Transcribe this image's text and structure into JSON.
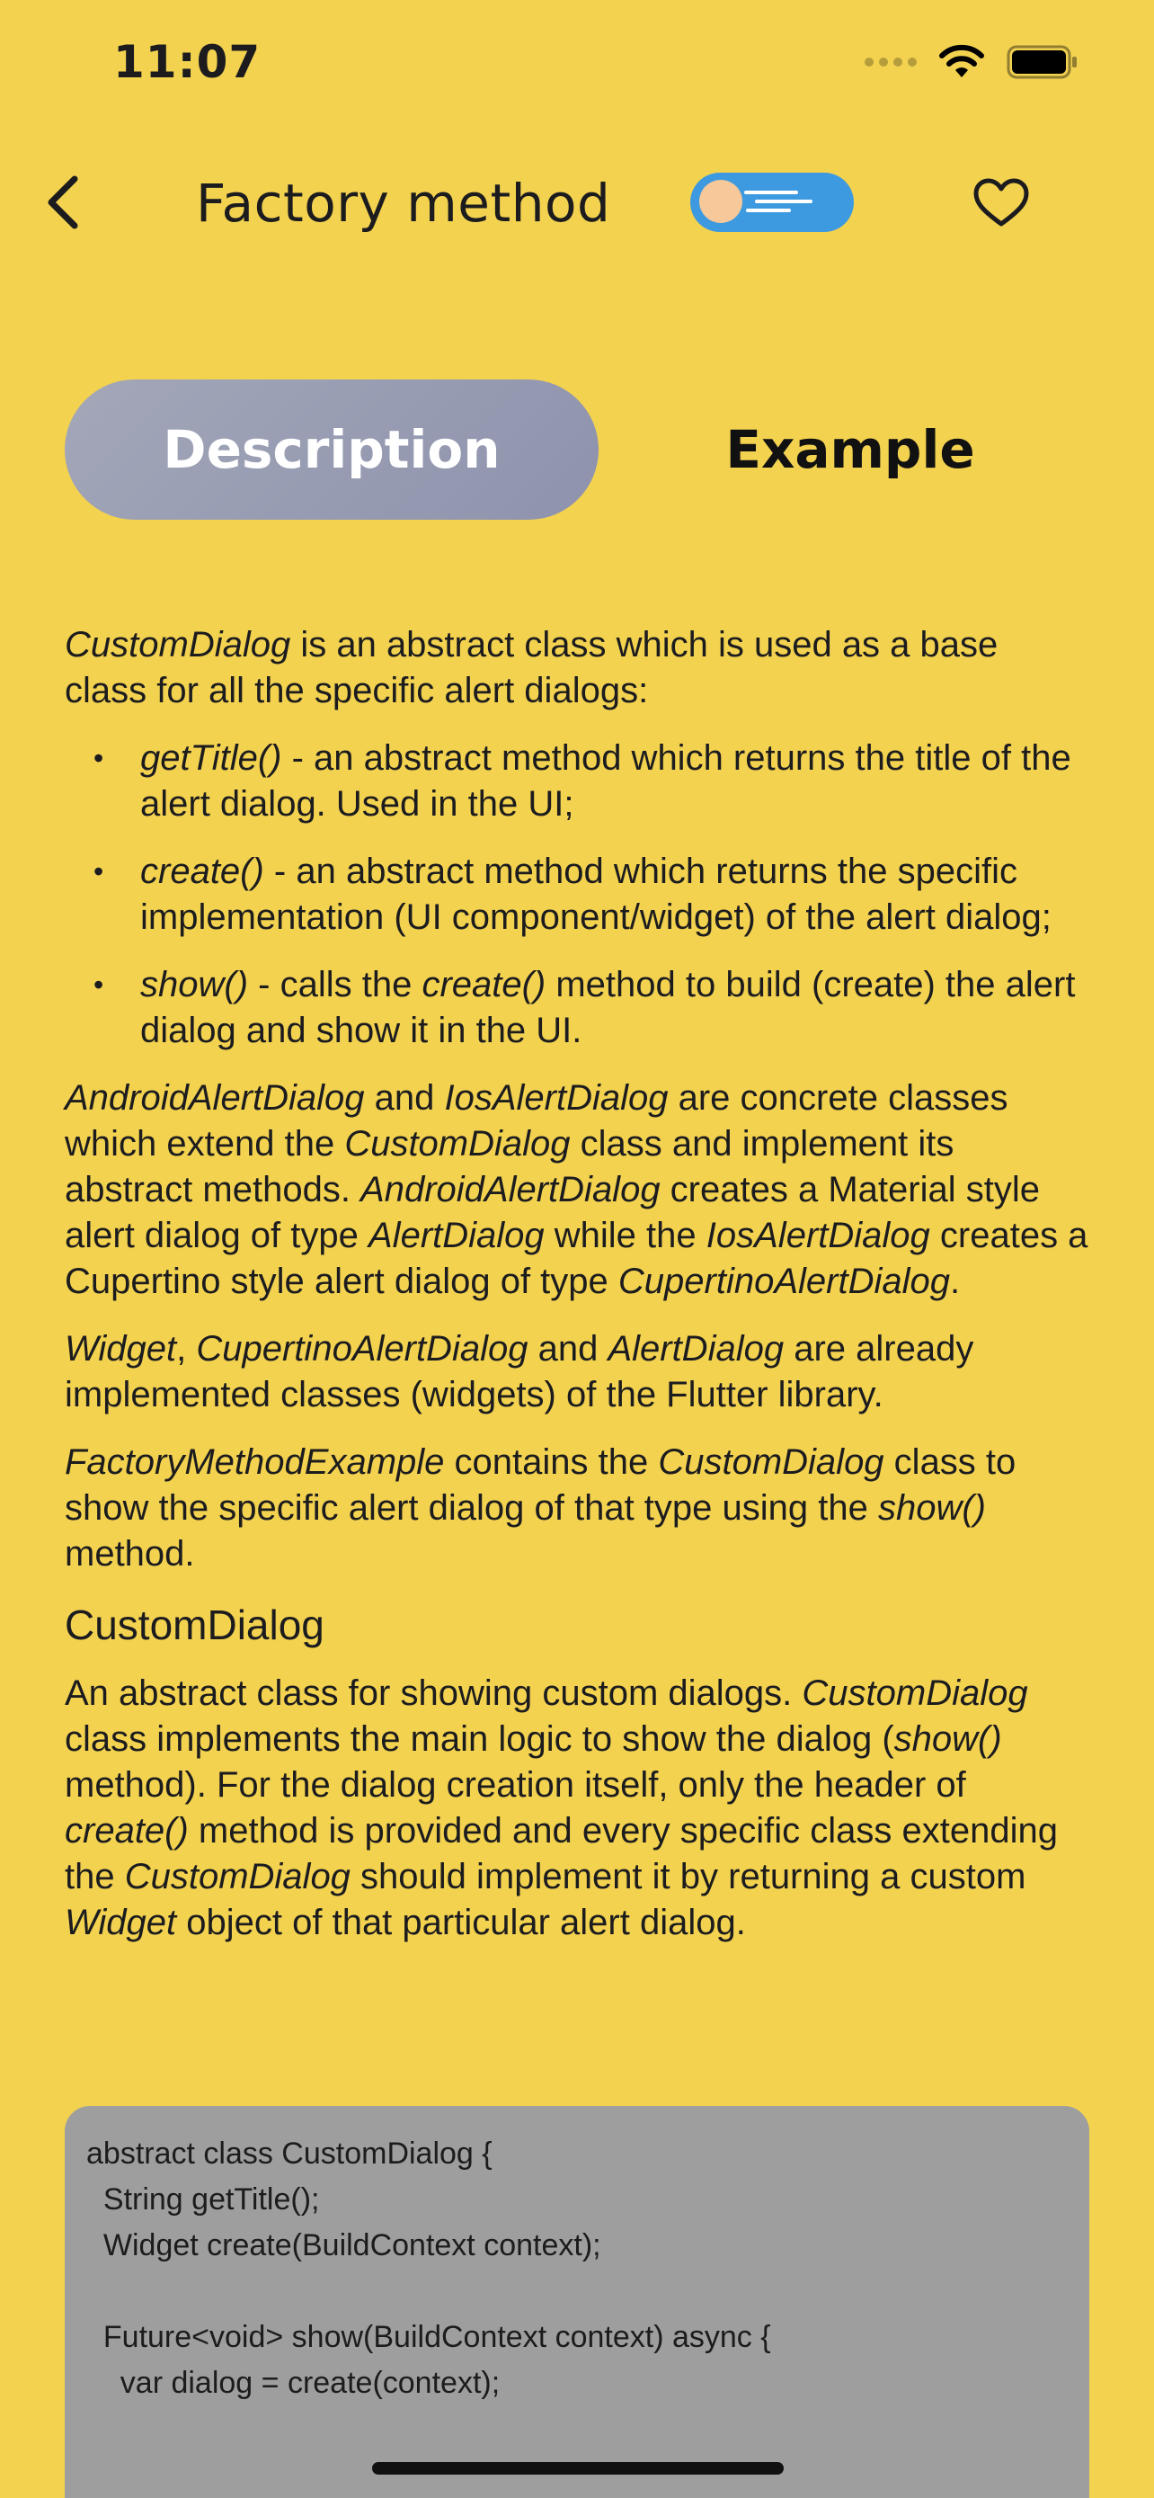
{
  "status_bar": {
    "time": "11:07"
  },
  "nav": {
    "title": "Factory method",
    "back_icon": "chevron-left-icon",
    "favorite_icon": "heart-outline-icon",
    "toggle_icon": "theme-toggle-comet-icon"
  },
  "tabs": {
    "description": "Description",
    "example": "Example",
    "selected": "Description"
  },
  "content": {
    "intro": {
      "t1": "CustomDialog",
      "t2": " is an abstract class which is used as a base class for all the specific alert dialogs:"
    },
    "bullets": [
      {
        "name": "getTitle()",
        "text": " - an abstract method which returns the title of the alert dialog. Used in the UI;"
      },
      {
        "name": "create()",
        "text": " - an abstract method which returns the specific implementation (UI component/widget) of the alert dialog;"
      },
      {
        "name": "show()",
        "text1": " - calls the ",
        "name2": "create()",
        "text2": " method to build (create) the alert dialog and show it in the UI."
      }
    ],
    "para2": {
      "a": "AndroidAlertDialog",
      "b": " and ",
      "c": "IosAlertDialog",
      "d": " are concrete classes which extend the ",
      "e": "CustomDialog",
      "f": " class and implement its abstract methods. ",
      "g": "AndroidAlertDialog",
      "h": " creates a Material style alert dialog of type ",
      "i": "AlertDialog",
      "j": " while the ",
      "k": "IosAlertDialog",
      "l": " creates a Cupertino style alert dialog of type ",
      "m": "CupertinoAlertDialog",
      "n": "."
    },
    "para3": {
      "a": "Widget",
      "b": ", ",
      "c": "CupertinoAlertDialog",
      "d": " and ",
      "e": "AlertDialog",
      "f": " are already implemented classes (widgets) of the Flutter library."
    },
    "para4": {
      "a": "FactoryMethodExample",
      "b": " contains the ",
      "c": "CustomDialog",
      "d": " class to show the specific alert dialog of that type using the ",
      "e": "show()",
      "f": " method."
    },
    "heading": "CustomDialog",
    "para5": {
      "a": "An abstract class for showing custom dialogs. ",
      "b": "CustomDialog",
      "c": " class implements the main logic to show the dialog (",
      "d": "show()",
      "e": " method). For the dialog creation itself, only the header of ",
      "f": "create()",
      "g": " method is provided and every specific class extending the ",
      "h": "CustomDialog",
      "i": " should implement it by returning a custom ",
      "j": "Widget",
      "k": " object of that particular alert dialog."
    }
  },
  "code": {
    "lines": [
      "abstract class CustomDialog {",
      "  String getTitle();",
      "  Widget create(BuildContext context);",
      "",
      "  Future<void> show(BuildContext context) async {",
      "    var dialog = create(context);"
    ]
  },
  "colors": {
    "background": "#F3D250",
    "tab_selected": "#8e92ad",
    "code_background": "#9e9e9e",
    "toggle": "#3d9ae0"
  }
}
